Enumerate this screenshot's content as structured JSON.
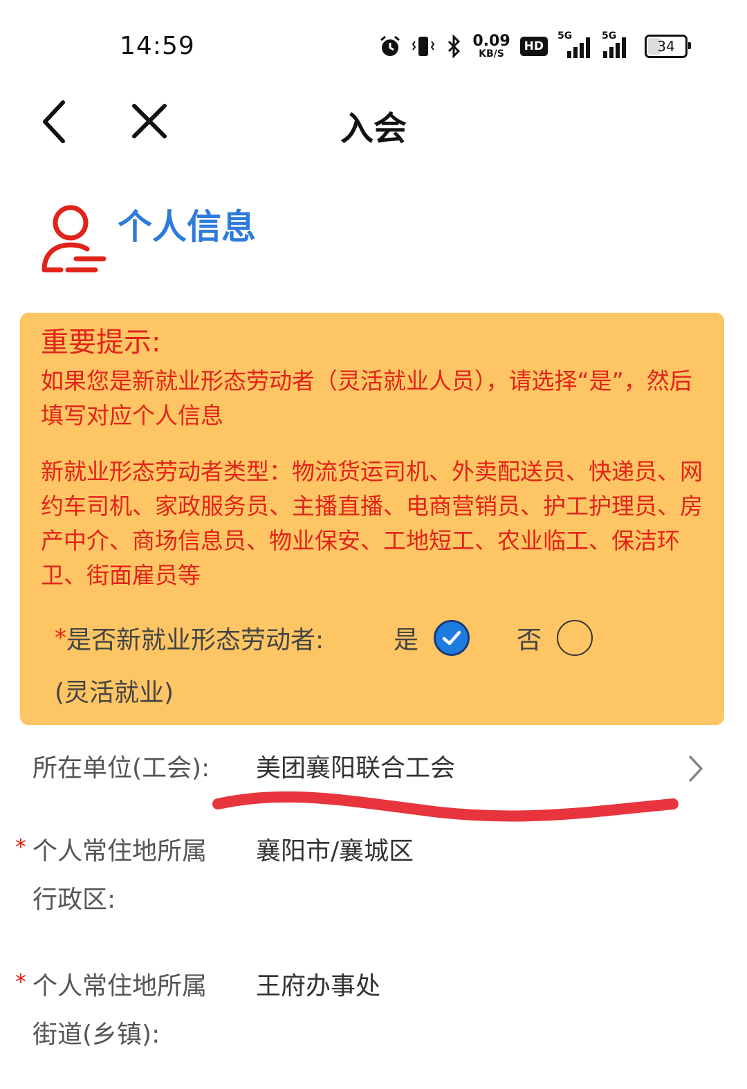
{
  "status_bar": {
    "time": "14:59",
    "net_speed_value": "0.09",
    "net_speed_unit": "KB/S",
    "hd_label": "HD",
    "network_1_label": "5G",
    "network_2_label": "5G",
    "battery_level": "34",
    "icons": [
      "alarm-icon",
      "vibrate-icon",
      "bluetooth-icon",
      "hd-icon",
      "signal-icon",
      "signal-icon",
      "battery-icon"
    ]
  },
  "nav": {
    "title": "入会"
  },
  "section": {
    "title": "个人信息",
    "icon": "person-icon"
  },
  "notice": {
    "title": "重要提示:",
    "paragraph_1": "如果您是新就业形态劳动者（灵活就业人员），请选择“是”，然后填写对应个人信息",
    "paragraph_2": "新就业形态劳动者类型：物流货运司机、外卖配送员、快递员、网约车司机、家政服务员、主播直播、电商营销员、护工护理员、房产中介、商场信息员、物业保安、工地短工、农业临工、保洁环卫、街面雇员等",
    "question_star": "*",
    "question_label": "是否新就业形态劳动者:",
    "question_sub": "(灵活就业)",
    "option_yes": "是",
    "option_no": "否",
    "selected": "是"
  },
  "form": {
    "unit_label": "所在单位(工会):",
    "unit_value": "美团襄阳联合工会",
    "region_star": "*",
    "region_label_line1": "个人常住地所属",
    "region_label_line2": "行政区:",
    "region_value": "襄阳市/襄城区",
    "street_star": "*",
    "street_label_line1": "个人常住地所属",
    "street_label_line2": "街道(乡镇):",
    "street_value": "王府办事处"
  },
  "colors": {
    "accent_blue": "#2f7bdc",
    "notice_bg": "#fdc564",
    "notice_text": "#e2231a",
    "radio_checked": "#1e7be0",
    "annotation_red": "#e8343c"
  }
}
